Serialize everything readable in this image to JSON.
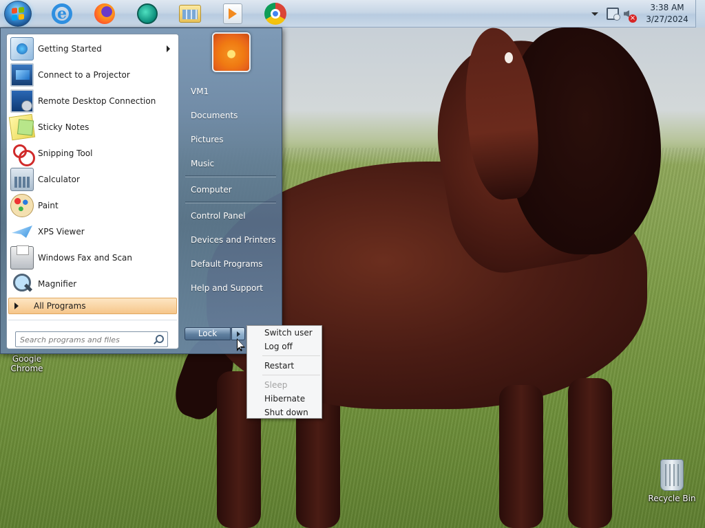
{
  "taskbar": {
    "pinned": [
      {
        "name": "Internet Explorer",
        "icon": "internet-explorer-icon"
      },
      {
        "name": "Firefox",
        "icon": "firefox-icon"
      },
      {
        "name": "App",
        "icon": "teal-app-icon"
      },
      {
        "name": "Windows Explorer",
        "icon": "folder-icon"
      },
      {
        "name": "Windows Media Player",
        "icon": "media-player-icon"
      },
      {
        "name": "Google Chrome",
        "icon": "chrome-icon"
      }
    ],
    "clock": {
      "time": "3:38 AM",
      "date": "3/27/2024"
    }
  },
  "start_menu": {
    "programs": [
      {
        "label": "Getting Started",
        "icon": "getting-started-icon",
        "has_submenu": true
      },
      {
        "label": "Connect to a Projector",
        "icon": "projector-icon"
      },
      {
        "label": "Remote Desktop Connection",
        "icon": "remote-desktop-icon"
      },
      {
        "label": "Sticky Notes",
        "icon": "sticky-notes-icon"
      },
      {
        "label": "Snipping Tool",
        "icon": "snipping-tool-icon"
      },
      {
        "label": "Calculator",
        "icon": "calculator-icon"
      },
      {
        "label": "Paint",
        "icon": "paint-icon"
      },
      {
        "label": "XPS Viewer",
        "icon": "xps-viewer-icon"
      },
      {
        "label": "Windows Fax and Scan",
        "icon": "fax-scan-icon"
      },
      {
        "label": "Magnifier",
        "icon": "magnifier-icon"
      }
    ],
    "all_programs": "All Programs",
    "search_placeholder": "Search programs and files",
    "right_links": [
      "VM1",
      "Documents",
      "Pictures",
      "Music",
      "Computer",
      "Control Panel",
      "Devices and Printers",
      "Default Programs",
      "Help and Support"
    ],
    "lock_label": "Lock"
  },
  "power_flyout": {
    "items": [
      {
        "label": "Switch user",
        "enabled": true
      },
      {
        "label": "Log off",
        "enabled": true
      },
      {
        "label": "Restart",
        "enabled": true
      },
      {
        "label": "Sleep",
        "enabled": false
      },
      {
        "label": "Hibernate",
        "enabled": true
      },
      {
        "label": "Shut down",
        "enabled": true
      }
    ]
  },
  "desktop": {
    "icons": [
      {
        "label": "Google Chrome",
        "icon": "chrome-icon"
      },
      {
        "label": "Recycle Bin",
        "icon": "recycle-bin-icon"
      }
    ]
  },
  "colors": {
    "accent_orange": "#f6c68a",
    "taskbar": "#c7d6e6",
    "menu_glass": "#56708c"
  }
}
